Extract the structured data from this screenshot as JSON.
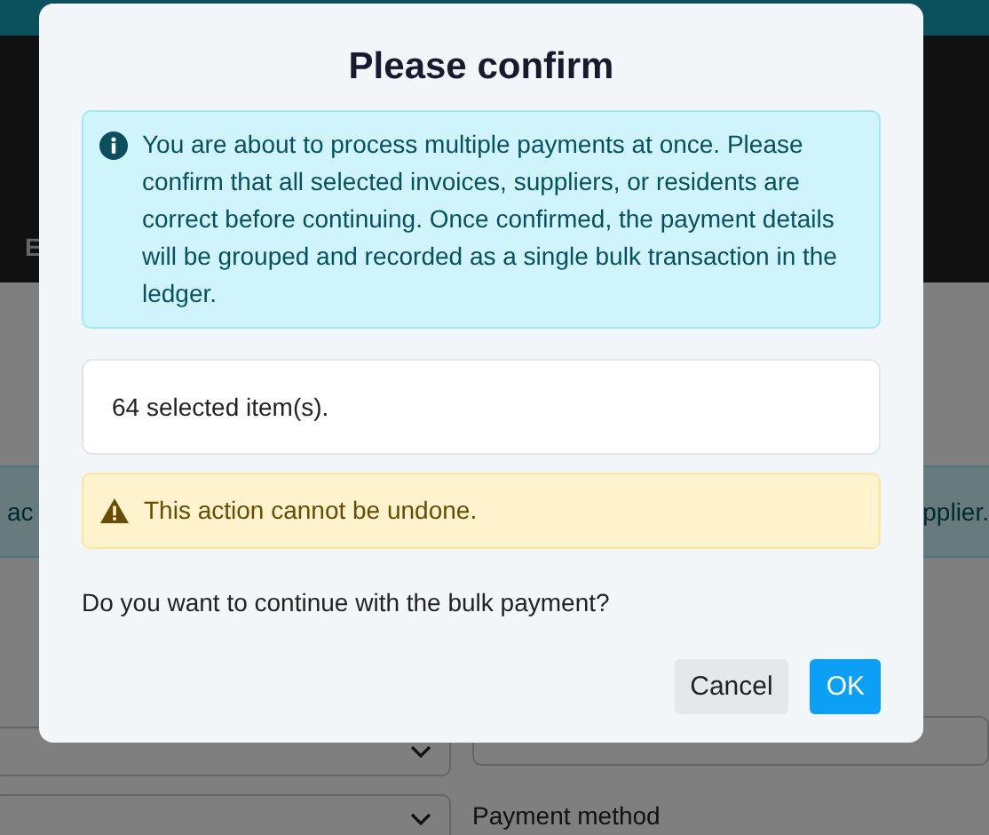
{
  "page": {
    "header_letter": "E",
    "notice_start": "ac",
    "notice_end": "pplier.",
    "payment_label": "Payment method"
  },
  "dialog": {
    "title": "Please confirm",
    "alerts": [
      {
        "kind": "info",
        "text": "You are about to process multiple payments at once. Please confirm that all selected invoices, suppliers, or residents are correct before continuing. Once confirmed, the payment details will be grouped and recorded as a single bulk transaction in the ledger."
      }
    ],
    "count": "64 selected item(s).",
    "warnings": [
      {
        "kind": "warning",
        "text": "This action cannot be undone."
      }
    ],
    "question": "Do you want to continue with the bulk payment?",
    "buttons": [
      {
        "label": "Cancel",
        "kind": "secondary"
      },
      {
        "label": "OK",
        "kind": "primary"
      }
    ]
  }
}
